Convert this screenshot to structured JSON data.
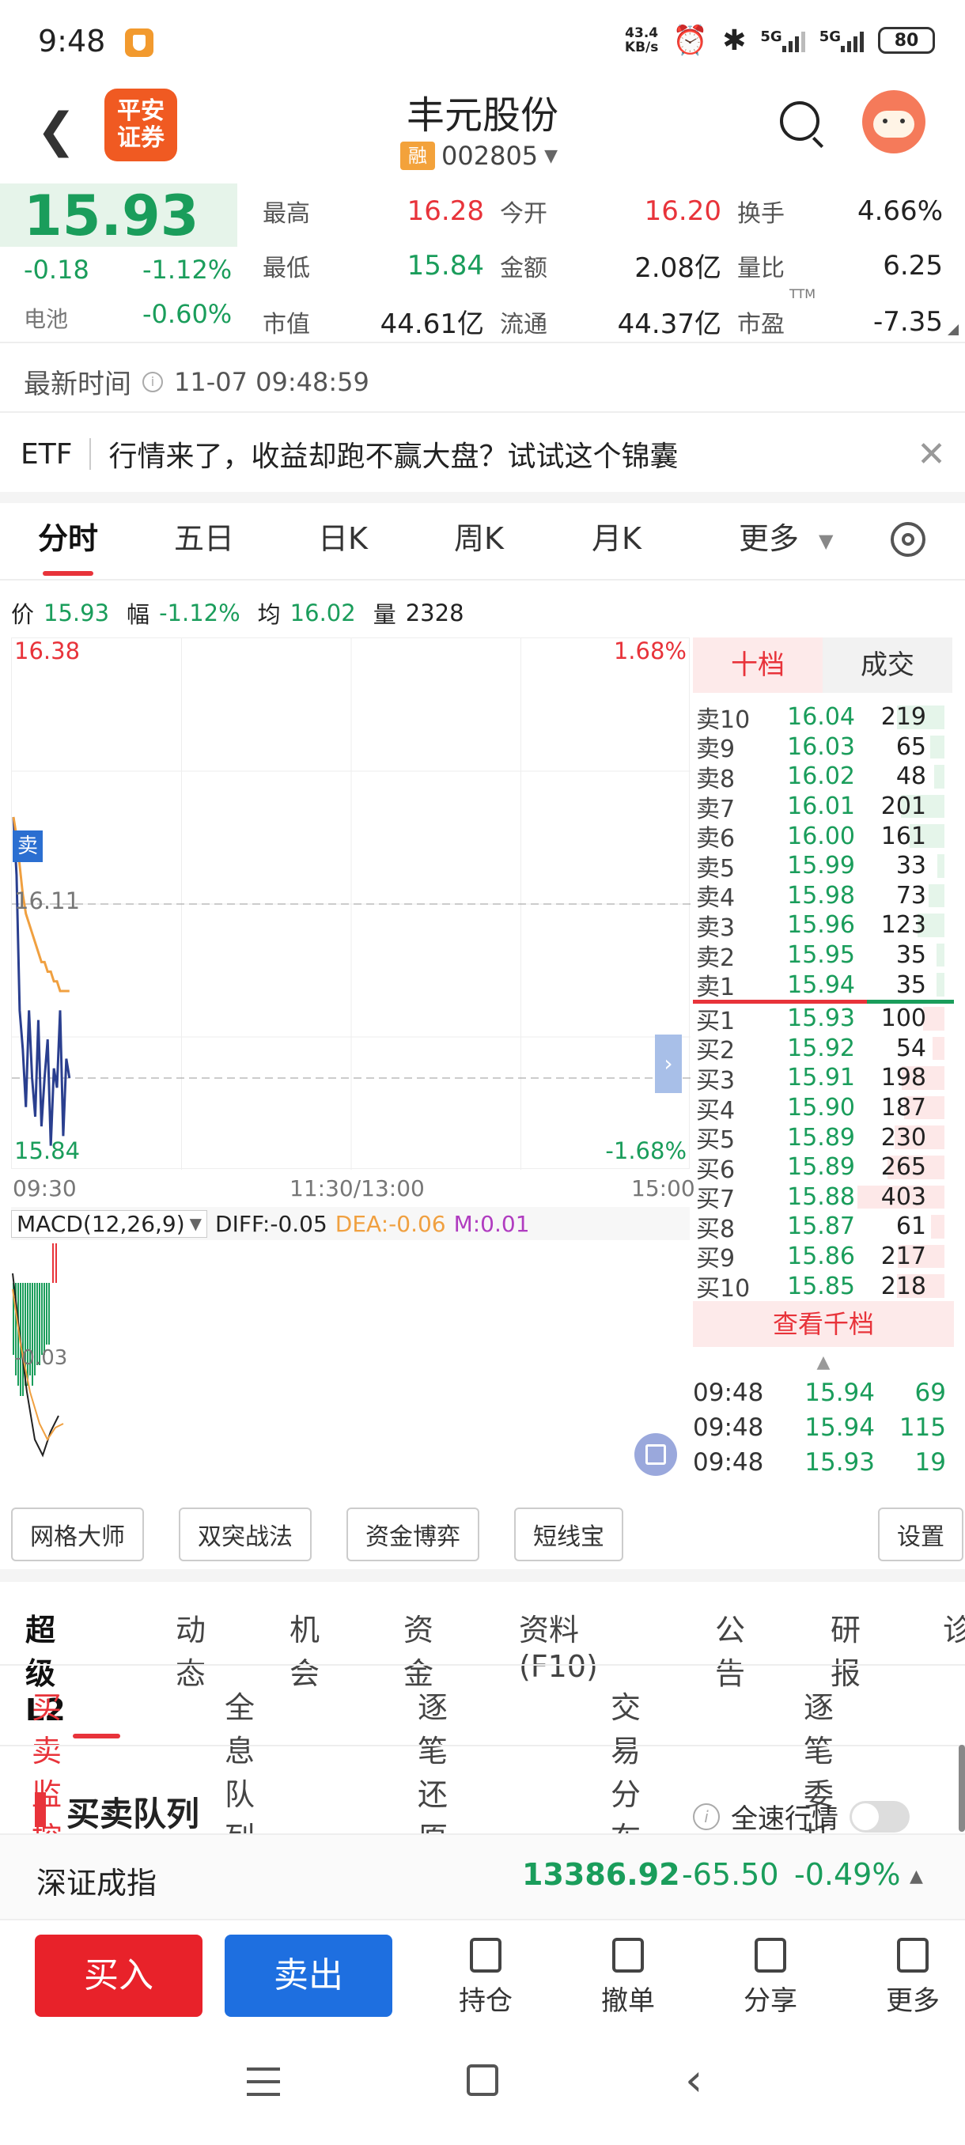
{
  "status_bar": {
    "time": "9:48",
    "net_speed_top": "43.4",
    "net_speed_unit": "KB/s",
    "sig1": "5G",
    "sig2": "5G",
    "battery": "80"
  },
  "header": {
    "broker_line1": "平安",
    "broker_line2": "证券",
    "stock_name": "丰元股份",
    "margin_tag": "融",
    "stock_code": "002805"
  },
  "quote": {
    "price": "15.93",
    "change": "-0.18",
    "change_pct": "-1.12%",
    "sector": "电池",
    "sector_pct": "-0.60%",
    "fields": [
      {
        "label": "最高",
        "value": "16.28",
        "color": "red"
      },
      {
        "label": "今开",
        "value": "16.20",
        "color": "red"
      },
      {
        "label": "换手",
        "value": "4.66%",
        "color": "dark"
      },
      {
        "label": "最低",
        "value": "15.84",
        "color": "green"
      },
      {
        "label": "金额",
        "value": "2.08亿",
        "color": "dark"
      },
      {
        "label": "量比",
        "value": "6.25",
        "color": "dark"
      },
      {
        "label": "市值",
        "value": "44.61亿",
        "color": "dark"
      },
      {
        "label": "流通",
        "value": "44.37亿",
        "color": "dark"
      },
      {
        "label": "市盈",
        "value": "-7.35",
        "color": "dark"
      }
    ],
    "ttm": "TTM"
  },
  "update": {
    "label": "最新时间",
    "time": "11-07 09:48:59"
  },
  "banner": {
    "tag": "ETF",
    "text": "行情来了，收益却跑不赢大盘？试试这个锦囊"
  },
  "chart_tabs": [
    "分时",
    "五日",
    "日K",
    "周K",
    "月K",
    "更多"
  ],
  "info_line": {
    "price_label": "价",
    "price": "15.93",
    "amp_label": "幅",
    "amp": "-1.12%",
    "avg_label": "均",
    "avg": "16.02",
    "vol_label": "量",
    "vol": "2328"
  },
  "chart": {
    "y_top": "16.38",
    "y_top_pct": "1.68%",
    "y_mid": "16.11",
    "y_bot": "15.84",
    "y_bot_pct": "-1.68%",
    "x_start": "09:30",
    "x_mid": "11:30/13:00",
    "x_end": "15:00",
    "sell_mark": "卖",
    "macd_label": "MACD(12,26,9)",
    "diff": "DIFF:-0.05",
    "dea": "DEA:-0.06",
    "m": "M:0.01",
    "macd_axis": "-0.03"
  },
  "chart_data": {
    "type": "line",
    "x": [
      "09:30",
      "09:31",
      "09:32",
      "09:33",
      "09:34",
      "09:35",
      "09:36",
      "09:37",
      "09:38",
      "09:39",
      "09:40",
      "09:41",
      "09:42",
      "09:43",
      "09:44",
      "09:45",
      "09:46",
      "09:47",
      "09:48"
    ],
    "series": [
      {
        "values": [
          16.2,
          16.14,
          16.0,
          15.96,
          15.9,
          16.0,
          15.93,
          15.89,
          15.99,
          15.88,
          15.93,
          15.97,
          15.86,
          15.94,
          15.92,
          16.0,
          15.87,
          15.95,
          15.93
        ]
      },
      {
        "values": [
          16.2,
          16.18,
          16.15,
          16.12,
          16.1,
          16.09,
          16.08,
          16.07,
          16.06,
          16.05,
          16.05,
          16.04,
          16.04,
          16.03,
          16.03,
          16.02,
          16.02,
          16.02,
          16.02
        ]
      }
    ],
    "ylim": [
      15.84,
      16.38
    ]
  },
  "orderbook": {
    "tab1": "十档",
    "tab2": "成交",
    "asks": [
      {
        "l": "卖10",
        "p": "16.04",
        "v": "219"
      },
      {
        "l": "卖9",
        "p": "16.03",
        "v": "65"
      },
      {
        "l": "卖8",
        "p": "16.02",
        "v": "48"
      },
      {
        "l": "卖7",
        "p": "16.01",
        "v": "201"
      },
      {
        "l": "卖6",
        "p": "16.00",
        "v": "161"
      },
      {
        "l": "卖5",
        "p": "15.99",
        "v": "33"
      },
      {
        "l": "卖4",
        "p": "15.98",
        "v": "73"
      },
      {
        "l": "卖3",
        "p": "15.96",
        "v": "123"
      },
      {
        "l": "卖2",
        "p": "15.95",
        "v": "35"
      },
      {
        "l": "卖1",
        "p": "15.94",
        "v": "35"
      }
    ],
    "bids": [
      {
        "l": "买1",
        "p": "15.93",
        "v": "100"
      },
      {
        "l": "买2",
        "p": "15.92",
        "v": "54"
      },
      {
        "l": "买3",
        "p": "15.91",
        "v": "198"
      },
      {
        "l": "买4",
        "p": "15.90",
        "v": "187"
      },
      {
        "l": "买5",
        "p": "15.89",
        "v": "230"
      },
      {
        "l": "买6",
        "p": "15.89",
        "v": "265"
      },
      {
        "l": "买7",
        "p": "15.88",
        "v": "403"
      },
      {
        "l": "买8",
        "p": "15.87",
        "v": "61"
      },
      {
        "l": "买9",
        "p": "15.86",
        "v": "217"
      },
      {
        "l": "买10",
        "p": "15.85",
        "v": "218"
      }
    ],
    "more": "查看千档",
    "trades": [
      {
        "t": "09:48",
        "p": "15.94",
        "v": "69"
      },
      {
        "t": "09:48",
        "p": "15.94",
        "v": "115"
      },
      {
        "t": "09:48",
        "p": "15.93",
        "v": "19"
      }
    ]
  },
  "tools": [
    "网格大师",
    "双突战法",
    "资金博弈",
    "短线宝"
  ],
  "tools_setting": "设置",
  "section_tabs": [
    "超级L2",
    "动态",
    "机会",
    "资金",
    "资料(F10)",
    "公告",
    "研报",
    "诊"
  ],
  "sub_tabs": [
    "买卖监控",
    "全息队列",
    "逐笔还原",
    "交易分布",
    "逐笔委托"
  ],
  "queue": {
    "title": "买卖队列",
    "fast_label": "全速行情"
  },
  "index_bar": {
    "name": "深证成指",
    "value": "13386.92",
    "change": "-65.50",
    "pct": "-0.49%"
  },
  "bottom": {
    "buy": "买入",
    "sell": "卖出",
    "items": [
      "持仓",
      "撤单",
      "分享",
      "更多"
    ]
  }
}
